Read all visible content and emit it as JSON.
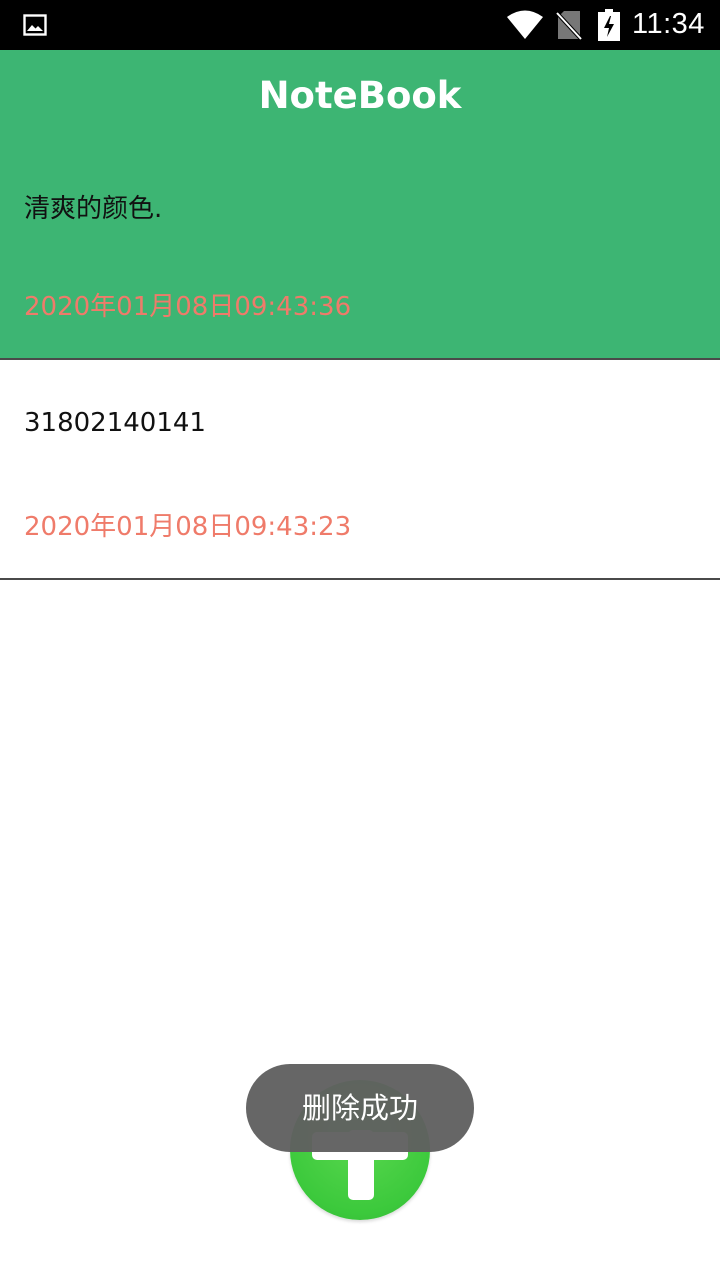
{
  "status_bar": {
    "time": "11:34",
    "icons": [
      "gallery-icon",
      "wifi-icon",
      "no-sim-icon",
      "battery-charging-icon"
    ]
  },
  "app_bar": {
    "title": "NoteBook"
  },
  "notes": [
    {
      "text": "清爽的颜色.",
      "date": "2020年01月08日09:43:36",
      "selected": true
    },
    {
      "text": "31802140141",
      "date": "2020年01月08日09:43:23",
      "selected": false
    }
  ],
  "fab": {
    "icon": "plus-icon"
  },
  "toast": {
    "message": "删除成功"
  },
  "colors": {
    "accent": "#3db573",
    "date_text": "#ef7b6a",
    "fab": "#3cc93c",
    "toast_bg": "#606060"
  }
}
